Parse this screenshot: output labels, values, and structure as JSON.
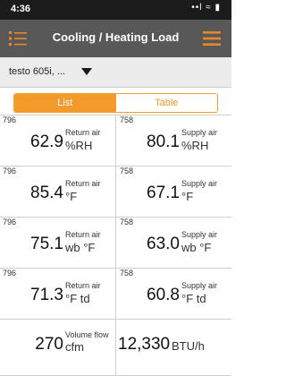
{
  "status_bar": {
    "time": "4:36",
    "signal_text": "••l ≈ ▮"
  },
  "nav": {
    "title": "Cooling / Heating Load",
    "left_icon": "list-edit-icon",
    "right_icon": "hamburger-menu-icon"
  },
  "device": {
    "name": "testo 605i, ..."
  },
  "tabs": [
    {
      "label": "List",
      "active": true
    },
    {
      "label": "Table",
      "active": false
    }
  ],
  "measurements": [
    {
      "sn": "796",
      "value": "62.9",
      "desc": "Return air",
      "unit": "%RH"
    },
    {
      "sn": "758",
      "value": "80.1",
      "desc": "Supply air",
      "unit": "%RH"
    },
    {
      "sn": "796",
      "value": "85.4",
      "desc": "Return air",
      "unit": "°F"
    },
    {
      "sn": "758",
      "value": "67.1",
      "desc": "Supply air",
      "unit": "°F"
    },
    {
      "sn": "796",
      "value": "75.1",
      "desc": "Return air",
      "unit": "wb °F"
    },
    {
      "sn": "758",
      "value": "63.0",
      "desc": "Supply air",
      "unit": "wb °F"
    },
    {
      "sn": "796",
      "value": "71.3",
      "desc": "Return air",
      "unit": "°F td"
    },
    {
      "sn": "758",
      "value": "60.8",
      "desc": "Supply air",
      "unit": "°F td"
    }
  ],
  "totals": {
    "volume_flow": {
      "value": "270",
      "desc": "Volume flow",
      "unit": "cfm"
    },
    "load": {
      "value": "12,330",
      "unit": "BTU/h"
    }
  },
  "colors": {
    "accent": "#f39a2a",
    "navbar": "#585858",
    "status_bar": "#1b1b1b"
  }
}
